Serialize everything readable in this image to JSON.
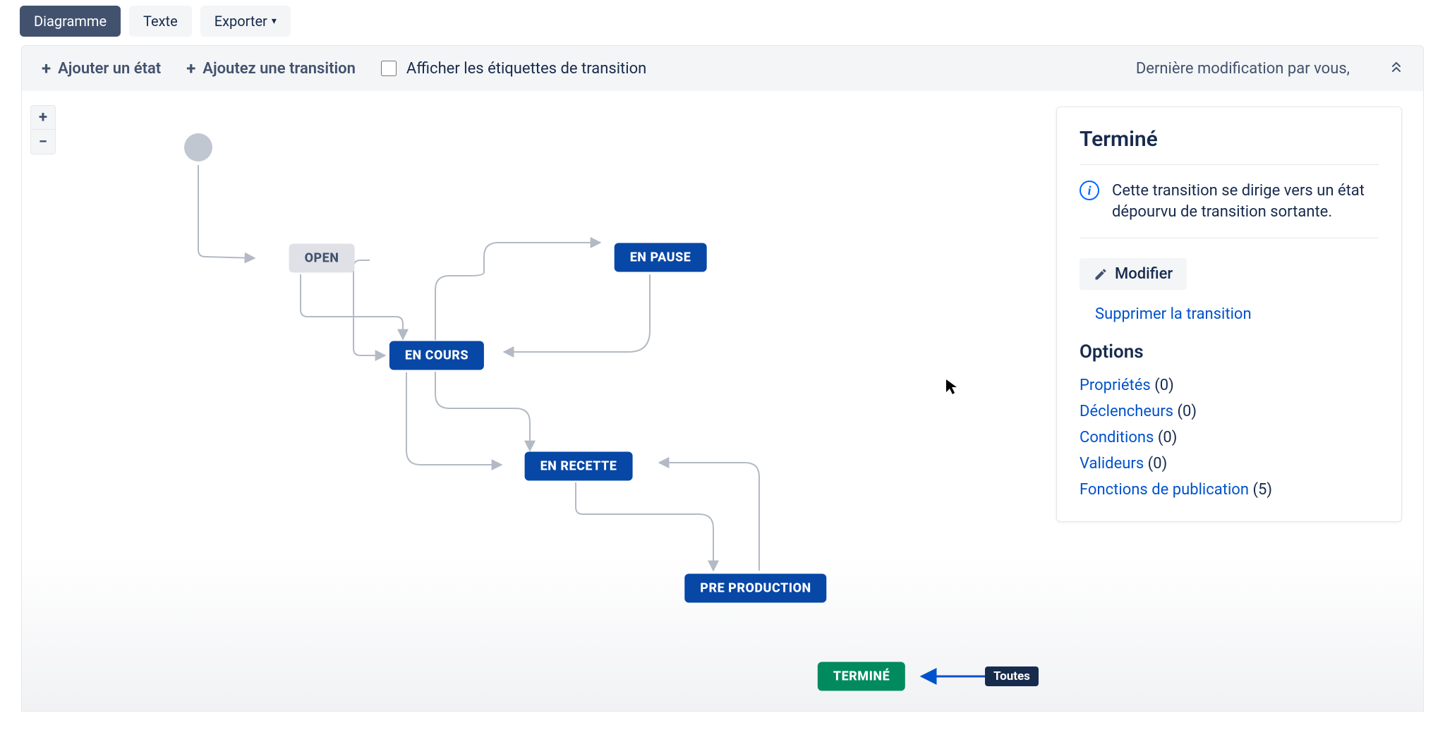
{
  "tabs": {
    "diagram": "Diagramme",
    "text": "Texte",
    "export": "Exporter"
  },
  "toolbar": {
    "add_state": "Ajouter un état",
    "add_transition": "Ajoutez une transition",
    "show_labels": "Afficher les étiquettes de transition",
    "last_modified": "Dernière modification par vous,"
  },
  "zoom": {
    "in": "+",
    "out": "−"
  },
  "states": {
    "open": "OPEN",
    "en_cours": "EN COURS",
    "en_pause": "EN PAUSE",
    "en_recette": "EN RECETTE",
    "pre_production": "PRE PRODUCTION",
    "termine": "TERMINÉ"
  },
  "transition_label": "Toutes",
  "panel": {
    "title": "Terminé",
    "info": "Cette transition se dirige vers un état dépourvu de transition sortante.",
    "edit": "Modifier",
    "delete": "Supprimer la transition",
    "options_heading": "Options",
    "options": {
      "props_label": "Propriétés",
      "props_count": "(0)",
      "triggers_label": "Déclencheurs",
      "triggers_count": "(0)",
      "conditions_label": "Conditions",
      "conditions_count": "(0)",
      "validators_label": "Valideurs",
      "validators_count": "(0)",
      "postfn_label": "Fonctions de publication",
      "postfn_count": "(5)"
    }
  }
}
